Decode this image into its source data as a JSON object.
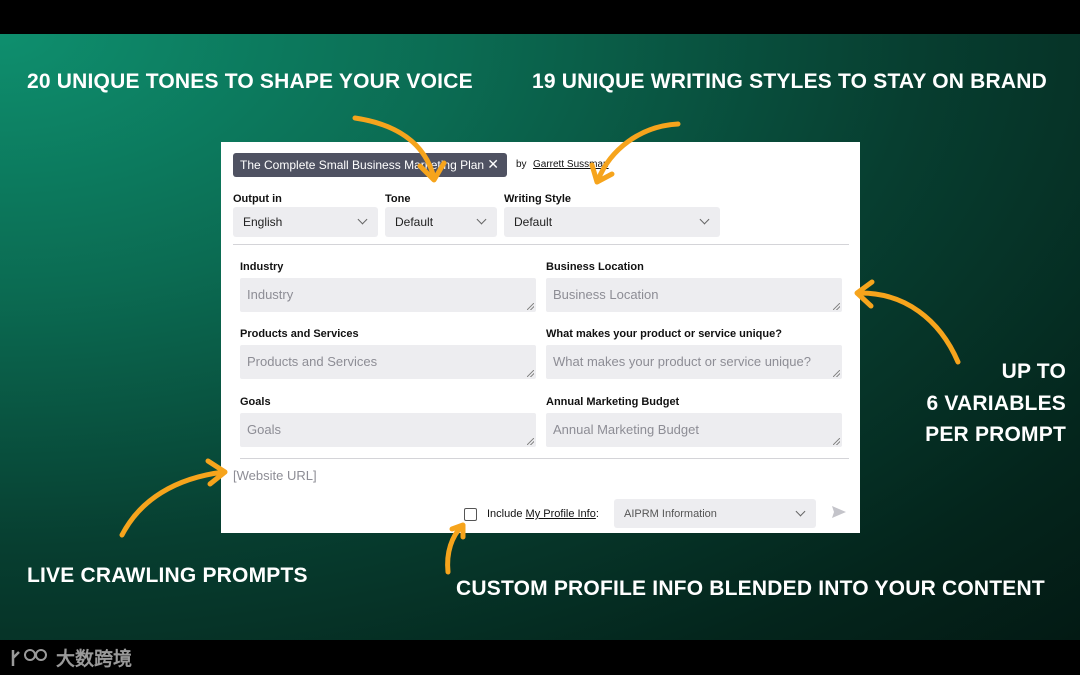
{
  "captions": {
    "tones": "20 UNIQUE TONES TO SHAPE YOUR VOICE",
    "styles": "19 UNIQUE WRITING STYLES TO STAY ON BRAND",
    "variables_line1": "UP TO",
    "variables_line2": "6 VARIABLES",
    "variables_line3": "PER PROMPT",
    "crawling": "LIVE CRAWLING PROMPTS",
    "profile": "CUSTOM PROFILE INFO BLENDED INTO YOUR CONTENT"
  },
  "prompt": {
    "title": "The Complete Small Business Marketing Plan",
    "by": "by",
    "author": "Garrett Sussman"
  },
  "controls": {
    "output_label": "Output in",
    "output_value": "English",
    "tone_label": "Tone",
    "tone_value": "Default",
    "style_label": "Writing Style",
    "style_value": "Default"
  },
  "fields": [
    {
      "label": "Industry",
      "placeholder": "Industry"
    },
    {
      "label": "Business Location",
      "placeholder": "Business Location"
    },
    {
      "label": "Products and Services",
      "placeholder": "Products and Services"
    },
    {
      "label": "What makes your product or service unique?",
      "placeholder": "What makes your product or service unique?"
    },
    {
      "label": "Goals",
      "placeholder": "Goals"
    },
    {
      "label": "Annual Marketing Budget",
      "placeholder": "Annual Marketing Budget"
    }
  ],
  "website_url": "[Website URL]",
  "profile": {
    "include_label": "Include",
    "link_label": "My Profile Info",
    "colon": ":",
    "select_value": "AIPRM Information",
    "checked": false
  },
  "watermark": "大数跨境",
  "colors": {
    "arrow": "#f6a41c",
    "chip": "#4f5262",
    "field_bg": "#ededf0",
    "bg_green": "#0b6b52"
  },
  "icons": [
    "close-icon",
    "chevron-down-icon",
    "send-icon",
    "resize-grip-icon"
  ]
}
